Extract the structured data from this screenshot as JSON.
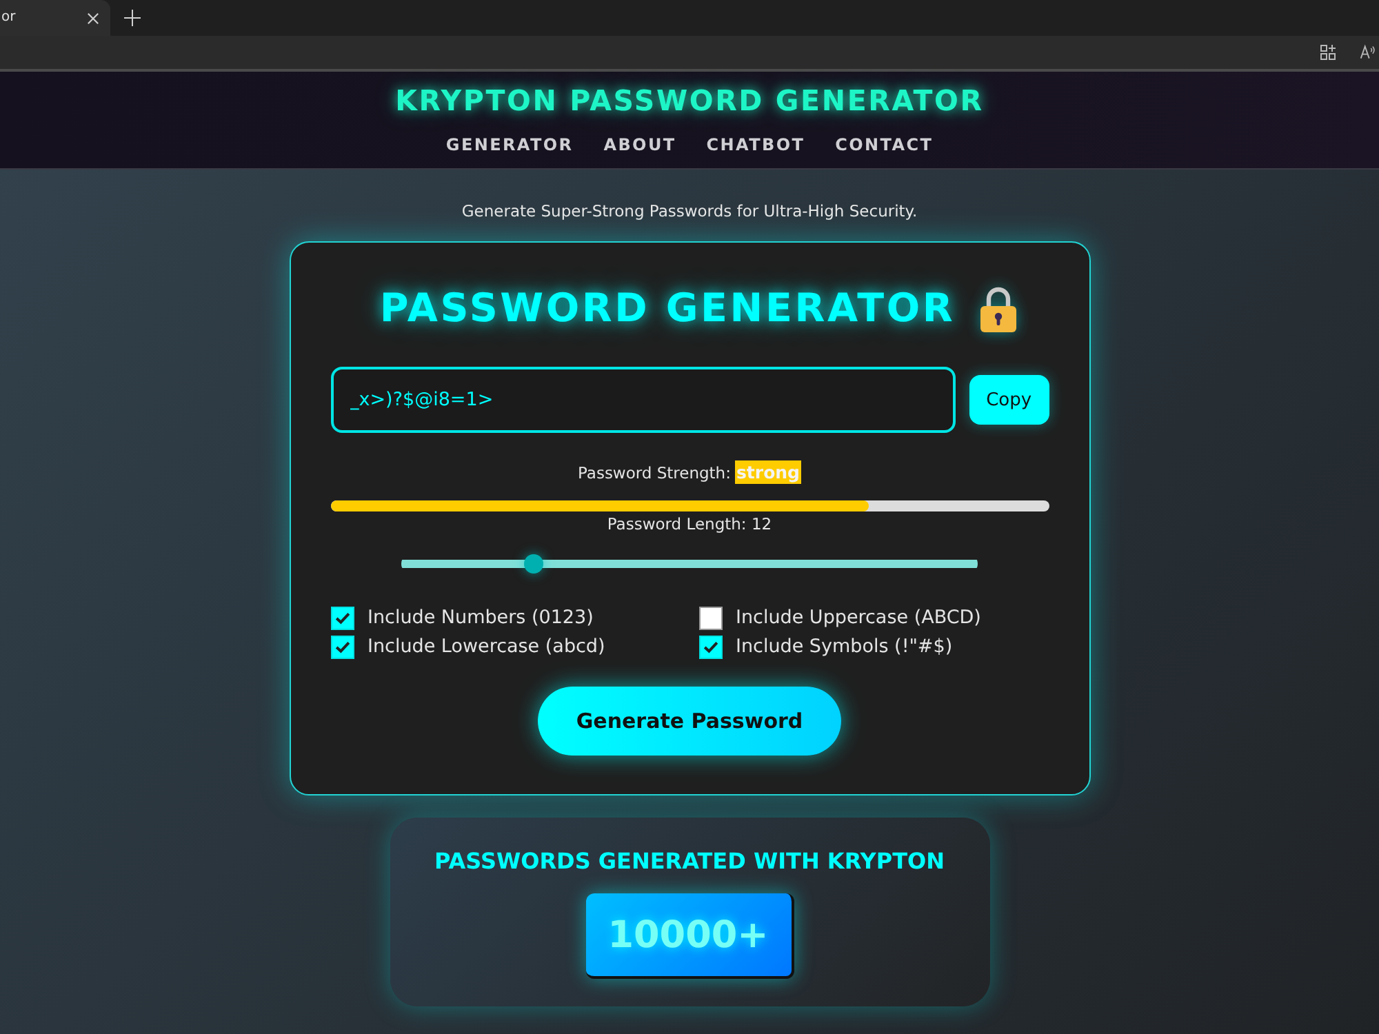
{
  "browser": {
    "tab_title": "or"
  },
  "header": {
    "title": "KRYPTON PASSWORD GENERATOR",
    "nav": [
      {
        "label": "GENERATOR"
      },
      {
        "label": "ABOUT"
      },
      {
        "label": "CHATBOT"
      },
      {
        "label": "CONTACT"
      }
    ]
  },
  "subtitle": "Generate Super-Strong Passwords for Ultra-High Security.",
  "generator": {
    "title": "PASSWORD GENERATOR",
    "password": "_x>)?$@i8=1>",
    "copy_button": "Copy",
    "strength": {
      "label": "Password Strength:",
      "value": "strong",
      "level": 0.75
    },
    "length": {
      "label": "Password Length: 12",
      "level": 0.23
    },
    "options": [
      {
        "label": "Include Numbers (0123)",
        "checked": true
      },
      {
        "label": "Include Uppercase (ABCD)",
        "checked": false
      },
      {
        "label": "Include Lowercase (abcd)",
        "checked": true
      },
      {
        "label": "Include Symbols (!\"#$)",
        "checked": true
      }
    ],
    "generate_button": "Generate Password"
  },
  "counter": {
    "title": "PASSWORDS GENERATED WITH KRYPTON",
    "value": "10000+"
  }
}
